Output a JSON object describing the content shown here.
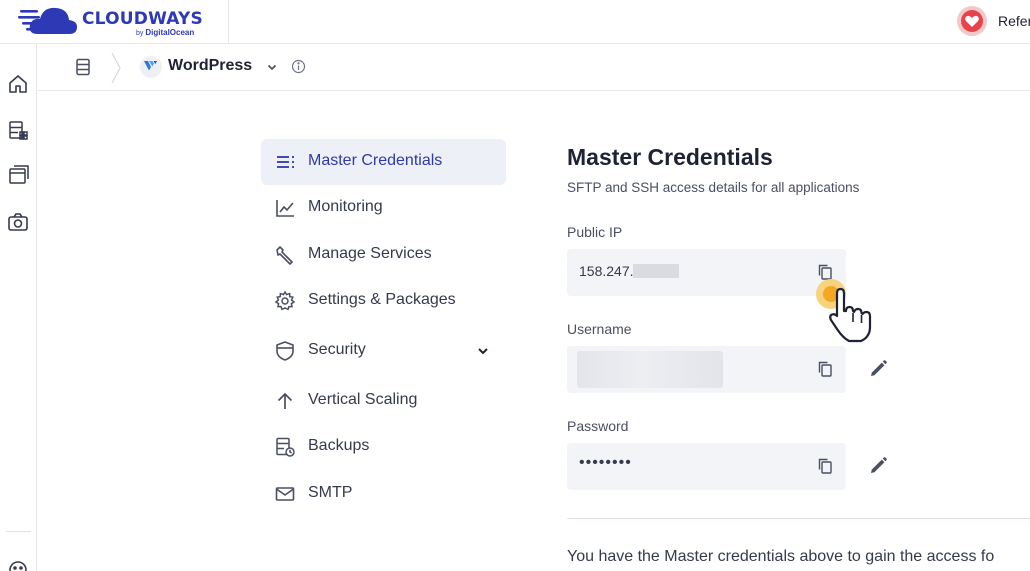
{
  "brand": {
    "name": "CLOUDWAYS",
    "sub_by": "by",
    "sub_company": "DigitalOcean",
    "accent": "#2e39b6"
  },
  "header": {
    "refer_label": "Refer"
  },
  "rail": {
    "items": [
      {
        "icon": "home-icon"
      },
      {
        "icon": "servers-icon"
      },
      {
        "icon": "applications-icon"
      },
      {
        "icon": "addons-icon"
      }
    ],
    "bottom_icon": "support-icon"
  },
  "subheader": {
    "app_name": "WordPress"
  },
  "nav": {
    "items": [
      {
        "label": "Master Credentials",
        "icon": "list-icon",
        "active": true
      },
      {
        "label": "Monitoring",
        "icon": "chart-icon"
      },
      {
        "label": "Manage Services",
        "icon": "wrench-icon"
      },
      {
        "label": "Settings & Packages",
        "icon": "gear-icon"
      },
      {
        "label": "Security",
        "icon": "shield-icon",
        "expandable": true
      },
      {
        "label": "Vertical Scaling",
        "icon": "arrow-up-icon"
      },
      {
        "label": "Backups",
        "icon": "backup-icon"
      },
      {
        "label": "SMTP",
        "icon": "mail-icon"
      }
    ],
    "active_color": "#2f3aa8",
    "active_bg": "#eef0f8"
  },
  "panel": {
    "title": "Master Credentials",
    "description": "SFTP and SSH access details for all applications",
    "public_ip_label": "Public IP",
    "public_ip_value": "158.247.",
    "username_label": "Username",
    "password_label": "Password",
    "password_value": "••••••••",
    "footer_text": "You have the Master credentials above to gain the access fo"
  }
}
